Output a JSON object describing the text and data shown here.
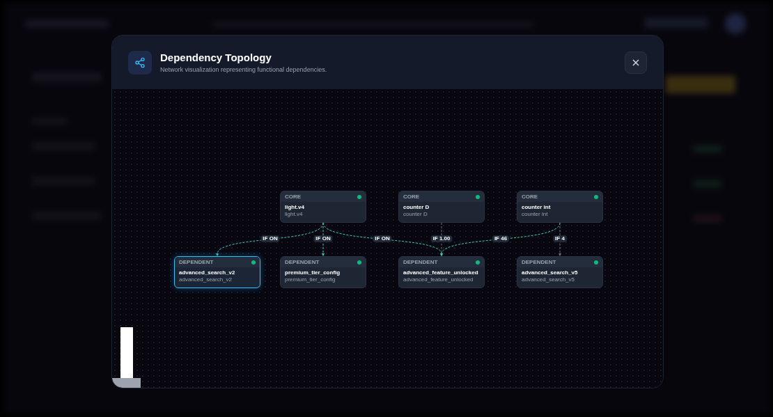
{
  "dialog": {
    "title": "Dependency Topology",
    "subtitle": "Network visualization representing functional dependencies."
  },
  "nodes": [
    {
      "role": "CORE",
      "name": "light.v4",
      "key": "light.v4",
      "selected": false
    },
    {
      "role": "CORE",
      "name": "counter D",
      "key": "counter D",
      "selected": false
    },
    {
      "role": "CORE",
      "name": "counter int",
      "key": "counter int",
      "selected": false
    },
    {
      "role": "DEPENDENT",
      "name": "advanced_search_v2",
      "key": "advanced_search_v2",
      "selected": true
    },
    {
      "role": "DEPENDENT",
      "name": "premium_tier_config",
      "key": "premium_tier_config",
      "selected": false
    },
    {
      "role": "DEPENDENT",
      "name": "advanced_feature_unlocked",
      "key": "advanced_feature_unlocked",
      "selected": false
    },
    {
      "role": "DEPENDENT",
      "name": "advanced_search_v5",
      "key": "advanced_search_v5",
      "selected": false
    }
  ],
  "edges": [
    {
      "label": "IF ON",
      "highlighted": true
    },
    {
      "label": "IF ON",
      "highlighted": true
    },
    {
      "label": "IF ON",
      "highlighted": true
    },
    {
      "label": "IF 1.00",
      "highlighted": false
    },
    {
      "label": "IF 46",
      "highlighted": true
    },
    {
      "label": "IF 4",
      "highlighted": false
    }
  ]
}
